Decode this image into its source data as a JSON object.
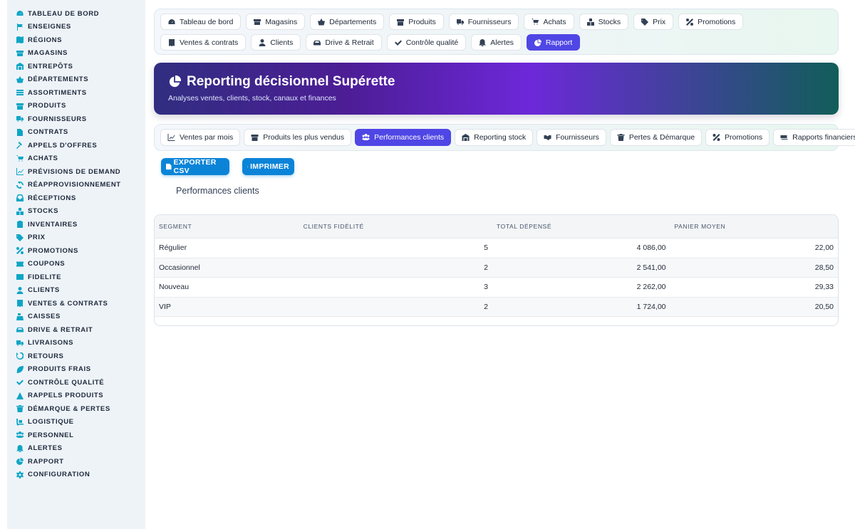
{
  "sidebar": {
    "items": [
      {
        "label": "TABLEAU DE BORD",
        "icon": "gauge-icon"
      },
      {
        "label": "ENSEIGNES",
        "icon": "flag-icon"
      },
      {
        "label": "RÉGIONS",
        "icon": "map-icon"
      },
      {
        "label": "MAGASINS",
        "icon": "store-icon"
      },
      {
        "label": "ENTREPÔTS",
        "icon": "warehouse-icon"
      },
      {
        "label": "DÉPARTEMENTS",
        "icon": "basket-icon"
      },
      {
        "label": "ASSORTIMENTS",
        "icon": "list-icon"
      },
      {
        "label": "PRODUITS",
        "icon": "box-icon"
      },
      {
        "label": "FOURNISSEURS",
        "icon": "truck-icon"
      },
      {
        "label": "CONTRATS",
        "icon": "file-icon"
      },
      {
        "label": "APPELS D'OFFRES",
        "icon": "gavel-icon"
      },
      {
        "label": "ACHATS",
        "icon": "cart-icon"
      },
      {
        "label": "PRÉVISIONS DE DEMAND",
        "icon": "chart-line-icon"
      },
      {
        "label": "RÉAPPROVISIONNEMENT",
        "icon": "refresh-icon"
      },
      {
        "label": "RÉCEPTIONS",
        "icon": "inbox-icon"
      },
      {
        "label": "STOCKS",
        "icon": "boxes-icon"
      },
      {
        "label": "INVENTAIRES",
        "icon": "clipboard-icon"
      },
      {
        "label": "PRIX",
        "icon": "tag-icon"
      },
      {
        "label": "PROMOTIONS",
        "icon": "percent-icon"
      },
      {
        "label": "COUPONS",
        "icon": "ticket-icon"
      },
      {
        "label": "FIDELITE",
        "icon": "card-icon"
      },
      {
        "label": "CLIENTS",
        "icon": "user-icon"
      },
      {
        "label": "VENTES & CONTRATS",
        "icon": "receipt-icon"
      },
      {
        "label": "CAISSES",
        "icon": "cash-register-icon"
      },
      {
        "label": "DRIVE & RETRAIT",
        "icon": "car-icon"
      },
      {
        "label": "LIVRAISONS",
        "icon": "delivery-icon"
      },
      {
        "label": "RETOURS",
        "icon": "undo-icon"
      },
      {
        "label": "PRODUITS FRAIS",
        "icon": "leaf-icon"
      },
      {
        "label": "CONTRÔLE QUALITÉ",
        "icon": "check-double-icon"
      },
      {
        "label": "RAPPELS PRODUITS",
        "icon": "warning-icon"
      },
      {
        "label": "DÉMARQUE & PERTES",
        "icon": "trash-icon"
      },
      {
        "label": "LOGISTIQUE",
        "icon": "dolly-icon"
      },
      {
        "label": "PERSONNEL",
        "icon": "users-icon"
      },
      {
        "label": "ALERTES",
        "icon": "bell-icon"
      },
      {
        "label": "RAPPORT",
        "icon": "pie-chart-icon"
      },
      {
        "label": "CONFIGURATION",
        "icon": "gear-icon"
      }
    ]
  },
  "topnav": {
    "items": [
      {
        "label": "Tableau de bord",
        "icon": "gauge-icon"
      },
      {
        "label": "Magasins",
        "icon": "store-icon"
      },
      {
        "label": "Départements",
        "icon": "basket-icon"
      },
      {
        "label": "Produits",
        "icon": "box-icon"
      },
      {
        "label": "Fournisseurs",
        "icon": "truck-icon"
      },
      {
        "label": "Achats",
        "icon": "cart-icon"
      },
      {
        "label": "Stocks",
        "icon": "boxes-icon"
      },
      {
        "label": "Prix",
        "icon": "tag-icon"
      },
      {
        "label": "Promotions",
        "icon": "percent-icon"
      },
      {
        "label": "Ventes & contrats",
        "icon": "receipt-icon"
      },
      {
        "label": "Clients",
        "icon": "user-icon"
      },
      {
        "label": "Drive & Retrait",
        "icon": "car-icon"
      },
      {
        "label": "Contrôle qualité",
        "icon": "check-double-icon"
      },
      {
        "label": "Alertes",
        "icon": "bell-icon"
      },
      {
        "label": "Rapport",
        "icon": "pie-chart-icon",
        "active": true
      }
    ]
  },
  "banner": {
    "title": "Reporting décisionnel Supérette",
    "subtitle": "Analyses ventes, clients, stock, canaux et finances"
  },
  "subtabs": {
    "items": [
      {
        "label": "Ventes par mois",
        "icon": "chart-line-icon"
      },
      {
        "label": "Produits les plus vendus",
        "icon": "box-icon"
      },
      {
        "label": "Performances clients",
        "icon": "users-icon",
        "active": true
      },
      {
        "label": "Reporting stock",
        "icon": "warehouse-icon"
      },
      {
        "label": "Fournisseurs",
        "icon": "handshake-icon"
      },
      {
        "label": "Pertes & Démarque",
        "icon": "trash-icon"
      },
      {
        "label": "Promotions",
        "icon": "percent-icon"
      },
      {
        "label": "Rapports financiers",
        "icon": "money-icon"
      }
    ]
  },
  "actions": {
    "export_label": "EXPORTER CSV",
    "print_label": "IMPRIMER"
  },
  "section": {
    "title": "Performances clients"
  },
  "table": {
    "headers": [
      "SEGMENT",
      "CLIENTS FIDÉLITÉ",
      "TOTAL DÉPENSÉ",
      "PANIER MOYEN"
    ],
    "rows": [
      [
        "Régulier",
        "5",
        "4 086,00",
        "22,00"
      ],
      [
        "Occasionnel",
        "2",
        "2 541,00",
        "28,50"
      ],
      [
        "Nouveau",
        "3",
        "2 262,00",
        "29,33"
      ],
      [
        "VIP",
        "2",
        "1 724,00",
        "20,50"
      ]
    ]
  },
  "colors": {
    "accent": "#4f46e5",
    "action": "#0b84d8",
    "sidebar_icon": "#0ea5c6"
  }
}
